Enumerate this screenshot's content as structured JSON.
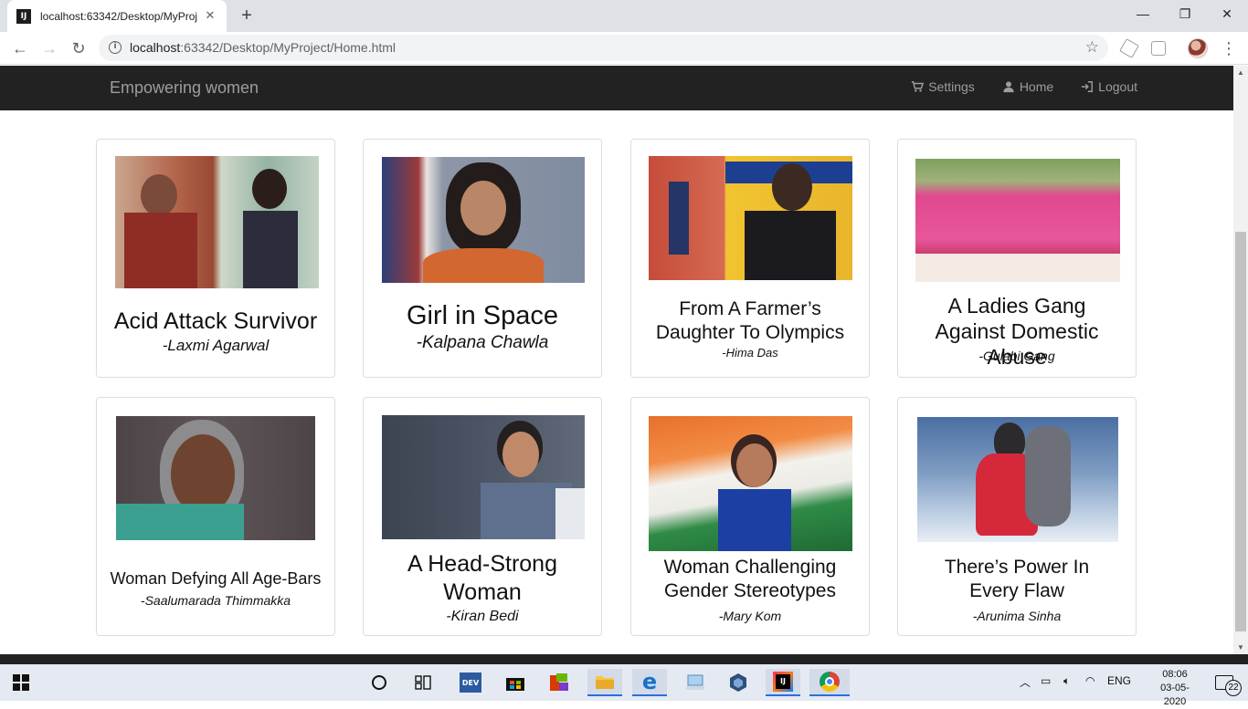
{
  "browser": {
    "tab_title": "localhost:63342/Desktop/MyProj",
    "tab_favicon": "IJ",
    "url_host": "localhost",
    "url_rest": ":63342/Desktop/MyProject/Home.html"
  },
  "navbar": {
    "brand": "Empowering women",
    "links": [
      {
        "label": "Settings",
        "icon": "cart-icon"
      },
      {
        "label": "Home",
        "icon": "user-icon"
      },
      {
        "label": "Logout",
        "icon": "logout-icon"
      }
    ]
  },
  "cards": [
    {
      "title": "Acid Attack Survivor",
      "subtitle": "-Laxmi Agarwal"
    },
    {
      "title": "Girl in Space",
      "subtitle": "-Kalpana Chawla"
    },
    {
      "title": "From A Farmer’s Daughter To Olympics",
      "subtitle": "-Hima Das"
    },
    {
      "title": "A Ladies Gang Against Domestic Abuse",
      "subtitle": "-Gulabi Gang"
    },
    {
      "title": "Woman Defying All Age-Bars",
      "subtitle": "-Saalumarada Thimmakka"
    },
    {
      "title": "A Head-Strong Woman",
      "subtitle": "-Kiran Bedi"
    },
    {
      "title": "Woman Challenging Gender Stereotypes",
      "subtitle": "-Mary Kom"
    },
    {
      "title": "There’s Power In Every Flaw",
      "subtitle": "-Arunima Sinha"
    }
  ],
  "taskbar": {
    "language": "ENG",
    "time": "08:06",
    "date": "03-05-2020",
    "notifications": "22"
  }
}
